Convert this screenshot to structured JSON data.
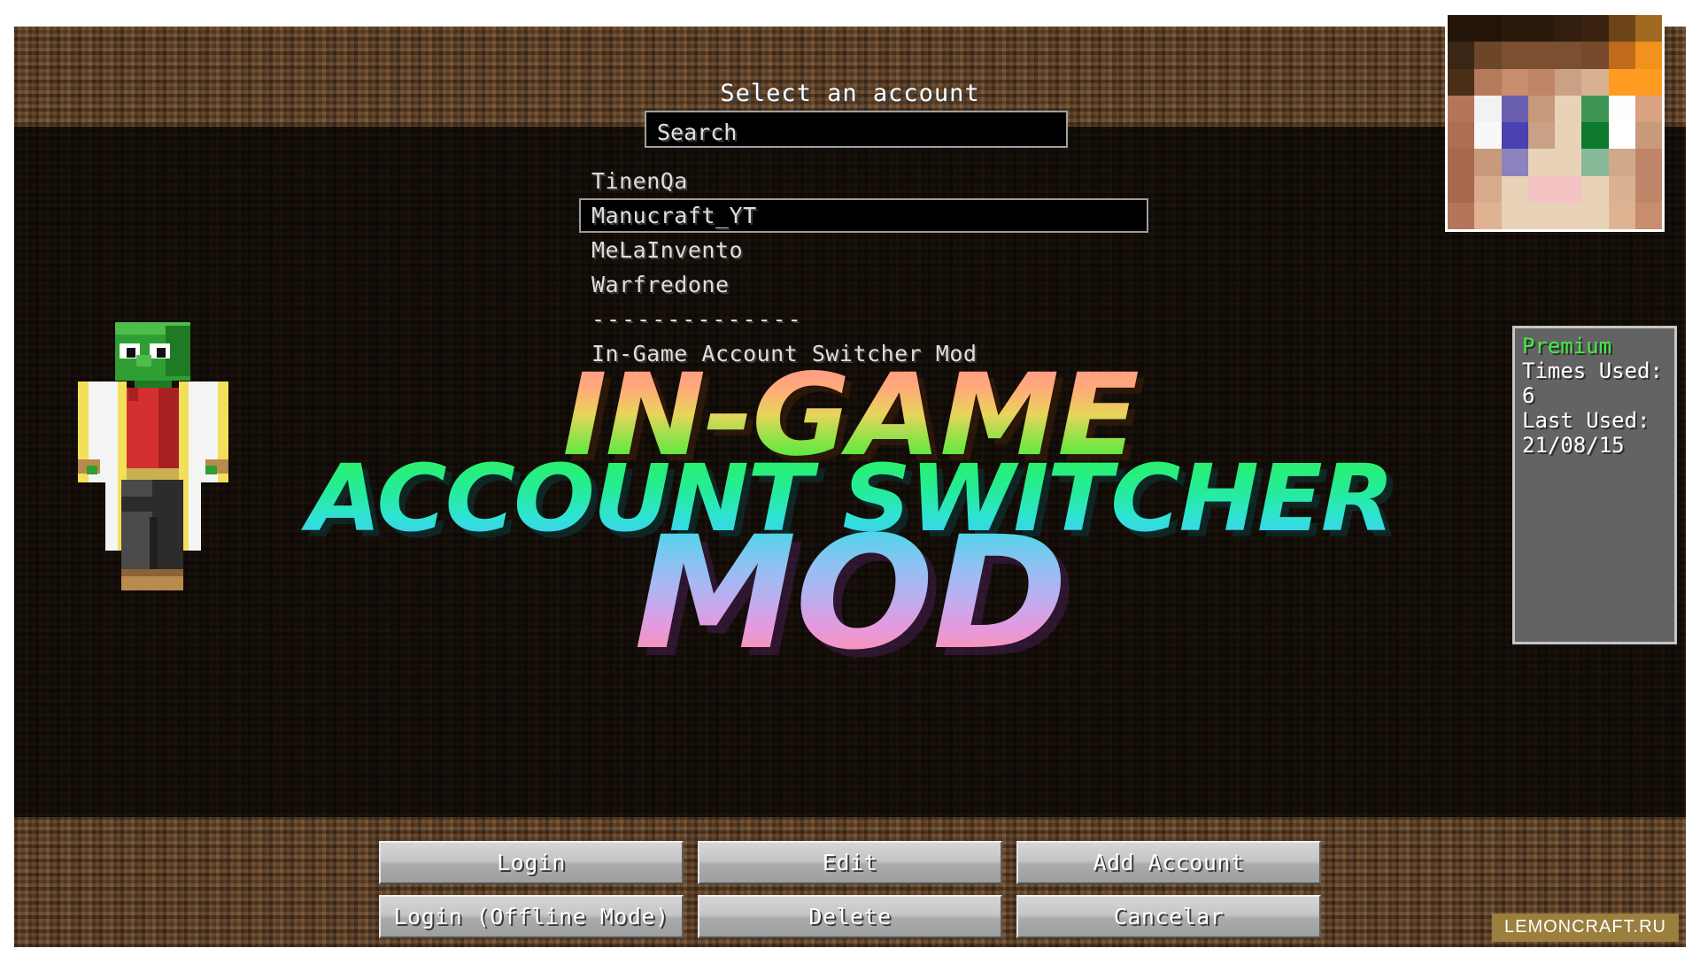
{
  "window": {
    "title": "Select an account"
  },
  "search": {
    "placeholder": "Search",
    "value": "Search"
  },
  "accounts": {
    "items": [
      {
        "name": "TinenQa",
        "selected": false,
        "type": "account"
      },
      {
        "name": "Manucraft_YT",
        "selected": true,
        "type": "account"
      },
      {
        "name": "MeLaInvento",
        "selected": false,
        "type": "account"
      },
      {
        "name": "Warfredone",
        "selected": false,
        "type": "account"
      },
      {
        "name": "--------------",
        "selected": false,
        "type": "divider"
      },
      {
        "name": "In-Game Account Switcher Mod",
        "selected": false,
        "type": "account"
      }
    ]
  },
  "info_panel": {
    "status": "Premium",
    "status_color": "#44ec44",
    "times_used_label": "Times Used:",
    "times_used_value": "6",
    "last_used_label": "Last Used:",
    "last_used_value": "21/08/15"
  },
  "logo": {
    "line1": "IN-GAME",
    "line2": "ACCOUNT SWITCHER",
    "line3": "MOD"
  },
  "buttons": {
    "row1": [
      {
        "label": "Login"
      },
      {
        "label": "Edit"
      },
      {
        "label": "Add Account"
      }
    ],
    "row2": [
      {
        "label": "Login (Offline Mode)"
      },
      {
        "label": "Delete"
      },
      {
        "label": "Cancelar"
      }
    ]
  },
  "watermark": {
    "text": "LEMONCRAFT.RU"
  },
  "skin_head": {
    "rows": [
      [
        "#231409",
        "#231409",
        "#2b1a0c",
        "#2b1a0c",
        "#321d0e",
        "#3a2210",
        "#6d4418",
        "#a06a22"
      ],
      [
        "#3a2614",
        "#6b4628",
        "#7a5030",
        "#7a5030",
        "#7a5030",
        "#76492a",
        "#c06a1c",
        "#f0921c"
      ],
      [
        "#4a2e18",
        "#b37a5c",
        "#c78d6c",
        "#c08468",
        "#caa184",
        "#d8b293",
        "#ff9b20",
        "#ff9b20"
      ],
      [
        "#b3765a",
        "#f2f2f2",
        "#6a5fae",
        "#c79a7c",
        "#e8d2b8",
        "#3e9654",
        "#fdfdfd",
        "#d9a281"
      ],
      [
        "#ad6f54",
        "#f8f8f8",
        "#4a42b0",
        "#caa184",
        "#e8d2b8",
        "#0d7a2e",
        "#ffffff",
        "#c79a7c"
      ],
      [
        "#a8684e",
        "#c79a7c",
        "#8b82c0",
        "#e8d2b8",
        "#e8d2b8",
        "#86b998",
        "#cfa98a",
        "#c08468"
      ],
      [
        "#a8684e",
        "#d8ab8c",
        "#e8d2b8",
        "#f3c3c3",
        "#f3c3c3",
        "#e8d2b8",
        "#d8b293",
        "#c08468"
      ],
      [
        "#b3765a",
        "#dfb392",
        "#e8d2b8",
        "#e8d2b8",
        "#e8d2b8",
        "#e8d2b8",
        "#dfb392",
        "#c78d6c"
      ]
    ]
  }
}
